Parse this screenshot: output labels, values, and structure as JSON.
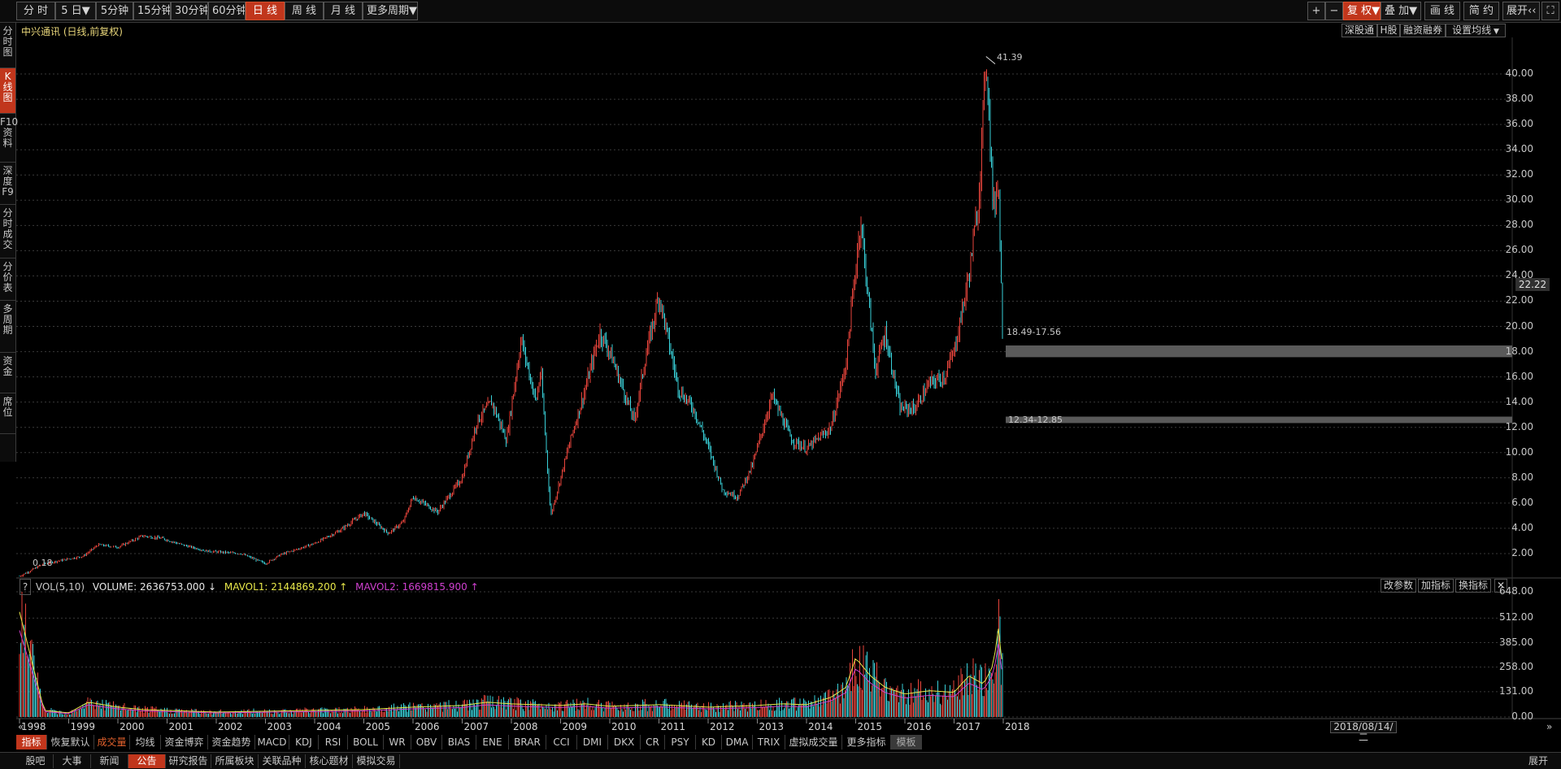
{
  "toolbar": {
    "periods": [
      "分 时",
      "5 日",
      "5分钟",
      "15分钟",
      "30分钟",
      "60分钟",
      "日 线",
      "周 线",
      "月 线",
      "更多周期"
    ],
    "active_period": "日 线",
    "right_buttons": [
      "+",
      "−",
      "复 权",
      "叠 加",
      "画 线",
      "简 约",
      "展开"
    ]
  },
  "left_tabs": [
    "分时图",
    "K线图",
    "F10资料",
    "深度F9",
    "分时成交",
    "分价表",
    "多周期",
    "资金",
    "席位"
  ],
  "stock": {
    "title": "中兴通讯 (日线,前复权)",
    "tools": [
      "深股通",
      "H股",
      "融资融券",
      "设置均线"
    ],
    "current_price_tag": "22.22",
    "high_label": "41.39",
    "low_label": "0.18",
    "zone_upper_label": "18.49-17.56",
    "zone_lower_label": "12.34-12.85"
  },
  "volume_panel": {
    "help": "?",
    "name": "VOL(5,10)",
    "volume": "VOLUME: 2636753.000",
    "mavol1": "MAVOL1: 2144869.200",
    "mavol2": "MAVOL2: 1669815.900",
    "buttons": [
      "改参数",
      "加指标",
      "换指标",
      "✕"
    ]
  },
  "chart_data": [
    {
      "type": "line",
      "title": "中兴通讯 (日线,前复权)",
      "x": [
        1998.0,
        1998.5,
        1999.3,
        1999.6,
        2000.0,
        2000.5,
        2000.9,
        2001.3,
        2001.8,
        2002.5,
        2003.0,
        2003.3,
        2004.0,
        2004.5,
        2005.0,
        2005.5,
        2005.8,
        2006.0,
        2006.5,
        2007.0,
        2007.3,
        2007.6,
        2007.9,
        2008.2,
        2008.5,
        2008.6,
        2008.8,
        2009.2,
        2009.5,
        2009.8,
        2010.0,
        2010.5,
        2010.7,
        2011.0,
        2011.4,
        2011.7,
        2012.0,
        2012.3,
        2012.6,
        2012.9,
        2013.3,
        2013.7,
        2014.0,
        2014.5,
        2014.8,
        2015.1,
        2015.4,
        2015.6,
        2015.9,
        2016.2,
        2016.5,
        2016.8,
        2017.0,
        2017.3,
        2017.5,
        2017.65,
        2017.7,
        2017.8,
        2017.9,
        2018.0
      ],
      "y": [
        0.2,
        1.2,
        1.8,
        2.7,
        2.5,
        3.4,
        3.2,
        2.7,
        2.2,
        2.0,
        1.2,
        1.9,
        2.8,
        3.8,
        5.2,
        3.6,
        4.5,
        6.5,
        5.3,
        8.0,
        12.5,
        14.0,
        11.0,
        19.0,
        14.0,
        16.5,
        5.0,
        11.0,
        15.0,
        19.5,
        18.0,
        12.5,
        17.0,
        22.5,
        15.0,
        13.5,
        10.5,
        7.0,
        6.5,
        9.0,
        14.5,
        11.0,
        10.3,
        12.0,
        17.0,
        28.5,
        16.5,
        19.5,
        13.5,
        13.5,
        15.5,
        16.0,
        18.0,
        24.0,
        30.0,
        41.4,
        38.0,
        29.0,
        32.0,
        17.0
      ],
      "ylim": [
        0,
        42
      ],
      "yticks": [
        "2.00",
        "4.00",
        "6.00",
        "8.00",
        "10.00",
        "12.00",
        "14.00",
        "16.00",
        "18.00",
        "20.00",
        "22.00",
        "24.00",
        "26.00",
        "28.00",
        "30.00",
        "32.00",
        "34.00",
        "36.00",
        "38.00",
        "40.00"
      ],
      "grid": true
    },
    {
      "type": "bar",
      "title": "VOL(5,10)",
      "x": [
        1998.0,
        1998.5,
        1999.0,
        1999.4,
        2000.0,
        2000.5,
        2001.0,
        2002.0,
        2003.0,
        2004.0,
        2005.0,
        2006.0,
        2007.0,
        2007.5,
        2008.0,
        2008.5,
        2009.0,
        2009.5,
        2010.0,
        2010.5,
        2011.0,
        2012.0,
        2013.0,
        2013.5,
        2014.0,
        2014.5,
        2014.8,
        2015.0,
        2015.3,
        2015.6,
        2016.0,
        2016.5,
        2017.0,
        2017.3,
        2017.6,
        2017.8,
        2017.9,
        2018.0
      ],
      "values": [
        640,
        40,
        25,
        90,
        60,
        45,
        40,
        30,
        35,
        40,
        45,
        60,
        70,
        90,
        80,
        75,
        70,
        80,
        65,
        70,
        75,
        60,
        70,
        80,
        75,
        120,
        180,
        360,
        250,
        180,
        140,
        160,
        150,
        250,
        200,
        320,
        540,
        260
      ],
      "ylim": [
        0,
        648
      ],
      "yticks": [
        "0.00",
        "131.00",
        "258.00",
        "385.00",
        "512.00",
        "648.00"
      ]
    }
  ],
  "x_axis_years": [
    "1998",
    "1999",
    "2000",
    "2001",
    "2002",
    "2003",
    "2004",
    "2005",
    "2006",
    "2007",
    "2008",
    "2009",
    "2010",
    "2011",
    "2012",
    "2013",
    "2014",
    "2015",
    "2016",
    "2017",
    "2018"
  ],
  "nav_arrow_left": "«",
  "nav_arrow_right": "»",
  "date_box": "2018/08/14/二",
  "indicators": [
    "指标",
    "恢复默认",
    "成交量",
    "均线",
    "资金博弈",
    "资金趋势",
    "MACD",
    "KDJ",
    "RSI",
    "BOLL",
    "WR",
    "OBV",
    "BIAS",
    "ENE",
    "BRAR",
    "CCI",
    "DMI",
    "DKX",
    "CR",
    "PSY",
    "KD",
    "DMA",
    "TRIX",
    "虚拟成交量",
    "更多指标",
    "模板"
  ],
  "bottom_tabs": [
    "股吧",
    "大事",
    "新闻",
    "公告",
    "研究报告",
    "所属板块",
    "关联品种",
    "核心题材",
    "模拟交易"
  ],
  "bottom_right": "展开",
  "colors": {
    "up": "#e8453c",
    "down": "#39d0d8",
    "accent": "#c1361c",
    "mavol1": "#e8e84a",
    "mavol2": "#d040d0",
    "title": "#e8d67a"
  }
}
